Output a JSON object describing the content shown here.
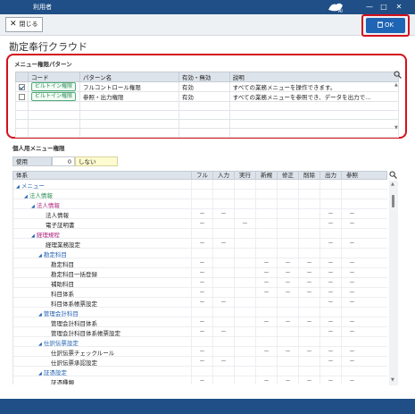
{
  "window": {
    "title": "利用者"
  },
  "toolbar": {
    "close_label": "閉じる",
    "ok_label": "OK"
  },
  "page_title": "勘定奉行クラウド",
  "pattern_section": {
    "label": "メニュー権限パターン",
    "columns": [
      "コード",
      "パターン名",
      "有効・無効",
      "説明"
    ],
    "rows": [
      {
        "checked": true,
        "code": "ビルトイン権限",
        "name": "フルコントロール権限",
        "status": "有効",
        "desc": "すべての業務メニューを操作できます。"
      },
      {
        "checked": false,
        "code": "ビルトイン権限",
        "name": "参照・出力権限",
        "status": "有効",
        "desc": "すべての業務メニューを参照でき、データを出力で…"
      }
    ]
  },
  "personal_section": {
    "label": "個人用メニュー権限",
    "usage_label": "使用",
    "usage_value": "0",
    "usage_desc": "しない",
    "columns": [
      "体系",
      "フル",
      "入力",
      "実行",
      "新規",
      "修正",
      "削除",
      "出力",
      "参照"
    ],
    "rows": [
      {
        "name": "メニュー",
        "cells": [
          "",
          "",
          "",
          "",
          "",
          "",
          "",
          ""
        ]
      },
      {
        "name": "法人情報",
        "cells": [
          "",
          "",
          "",
          "",
          "",
          "",
          "",
          ""
        ]
      },
      {
        "name": "法人情報",
        "cells": [
          "",
          "",
          "",
          "",
          "",
          "",
          "",
          ""
        ]
      },
      {
        "name": "法人情報",
        "cells": [
          "－",
          "－",
          "",
          "",
          "",
          "",
          "－",
          "－"
        ]
      },
      {
        "name": "電子証明書",
        "cells": [
          "－",
          "",
          "－",
          "",
          "",
          "",
          "－",
          "－"
        ]
      },
      {
        "name": "経理規程",
        "cells": [
          "",
          "",
          "",
          "",
          "",
          "",
          "",
          ""
        ]
      },
      {
        "name": "経理業務設定",
        "cells": [
          "－",
          "－",
          "",
          "",
          "",
          "",
          "－",
          "－"
        ]
      },
      {
        "name": "勘定科目",
        "cells": [
          "",
          "",
          "",
          "",
          "",
          "",
          "",
          ""
        ]
      },
      {
        "name": "勘定科目",
        "cells": [
          "－",
          "",
          "",
          "－",
          "－",
          "－",
          "－",
          "－"
        ]
      },
      {
        "name": "勘定科目一括登録",
        "cells": [
          "－",
          "",
          "",
          "－",
          "－",
          "－",
          "－",
          "－"
        ]
      },
      {
        "name": "補助科目",
        "cells": [
          "－",
          "",
          "",
          "－",
          "－",
          "－",
          "－",
          "－"
        ]
      },
      {
        "name": "科目体系",
        "cells": [
          "－",
          "",
          "",
          "－",
          "－",
          "－",
          "－",
          "－"
        ]
      },
      {
        "name": "科目体系帳票設定",
        "cells": [
          "－",
          "－",
          "",
          "",
          "",
          "",
          "－",
          "－"
        ]
      },
      {
        "name": "管理会計科目",
        "cells": [
          "",
          "",
          "",
          "",
          "",
          "",
          "",
          ""
        ]
      },
      {
        "name": "管理会計科目体系",
        "cells": [
          "－",
          "",
          "",
          "－",
          "－",
          "－",
          "－",
          "－"
        ]
      },
      {
        "name": "管理会計科目体系帳票設定",
        "cells": [
          "－",
          "－",
          "",
          "",
          "",
          "",
          "－",
          "－"
        ]
      },
      {
        "name": "仕訳伝票設定",
        "cells": [
          "",
          "",
          "",
          "",
          "",
          "",
          "",
          ""
        ]
      },
      {
        "name": "仕訳伝票チェックルール",
        "cells": [
          "－",
          "",
          "",
          "－",
          "－",
          "－",
          "－",
          "－"
        ]
      },
      {
        "name": "仕訳伝票承認設定",
        "cells": [
          "－",
          "－",
          "",
          "",
          "",
          "",
          "－",
          "－"
        ]
      },
      {
        "name": "証憑設定",
        "cells": [
          "",
          "",
          "",
          "",
          "",
          "",
          "",
          ""
        ]
      },
      {
        "name": "証憑種類",
        "cells": [
          "－",
          "",
          "",
          "－",
          "－",
          "－",
          "－",
          "－"
        ]
      }
    ]
  },
  "colors": {
    "titlebar": "#1f4f86",
    "ok_button": "#1f65b5",
    "highlight": "#d3111c",
    "tag_green": "#2f8f57"
  }
}
